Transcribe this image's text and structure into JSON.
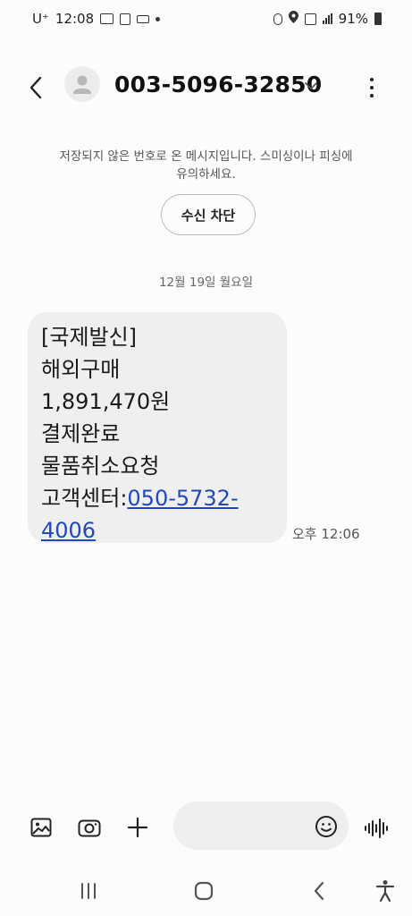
{
  "status_bar": {
    "carrier": "U⁺",
    "time": "12:08",
    "battery": "91%"
  },
  "header": {
    "contact": "003-5096-32850"
  },
  "notice": {
    "line1": "저장되지 않은 번호로 온 메시지입니다. 스미싱이나 피싱에",
    "line2": "유의하세요."
  },
  "block_button": "수신 차단",
  "date_separator": "12월 19일 월요일",
  "message": {
    "lines": [
      "[국제발신]",
      "해외구매",
      "1,891,470원",
      "결제완료",
      "물품취소요청"
    ],
    "last_prefix": "고객센터:",
    "link_part1": "050-5732-",
    "link_part2": "4006",
    "time": "오후 12:06"
  },
  "icons": {
    "back": "back-arrow-icon",
    "avatar": "person-icon",
    "expand": "chevron-down-icon",
    "menu": "more-vertical-icon",
    "gallery": "image-icon",
    "camera": "camera-icon",
    "add": "plus-icon",
    "emoji": "emoji-icon",
    "voice": "voice-wave-icon",
    "recents": "recents-icon",
    "home": "home-icon",
    "nav_back": "nav-back-icon",
    "accessibility": "accessibility-icon"
  }
}
